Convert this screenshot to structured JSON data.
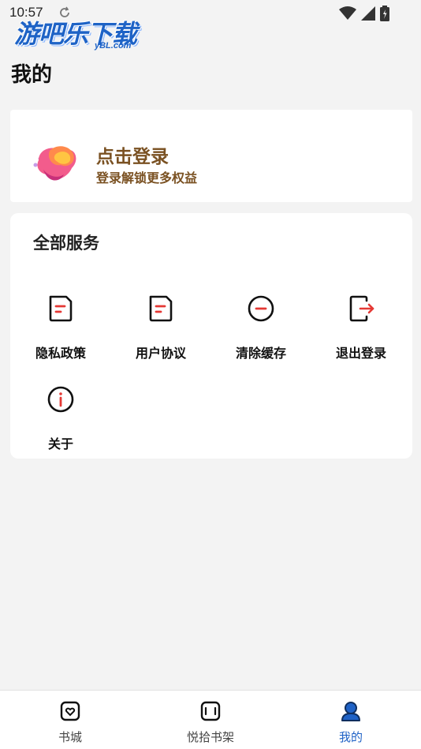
{
  "status_bar": {
    "time": "10:57"
  },
  "watermark": {
    "title": "游吧乐下载",
    "sub": "yBL.com"
  },
  "page": {
    "title": "我的"
  },
  "login": {
    "title": "点击登录",
    "subtitle": "登录解锁更多权益"
  },
  "services": {
    "title": "全部服务",
    "items": [
      {
        "label": "隐私政策",
        "icon": "document-icon"
      },
      {
        "label": "用户协议",
        "icon": "document-icon"
      },
      {
        "label": "清除缓存",
        "icon": "minus-circle-icon"
      },
      {
        "label": "退出登录",
        "icon": "logout-icon"
      },
      {
        "label": "关于",
        "icon": "info-icon"
      }
    ]
  },
  "bottom_nav": {
    "items": [
      {
        "label": "书城",
        "icon": "bookstore-icon"
      },
      {
        "label": "悦拾书架",
        "icon": "bookshelf-icon"
      },
      {
        "label": "我的",
        "icon": "profile-icon",
        "active": true
      }
    ]
  },
  "colors": {
    "accent": "#1f62c6",
    "login_text": "#7a5122",
    "logout_arrow": "#e53935"
  }
}
